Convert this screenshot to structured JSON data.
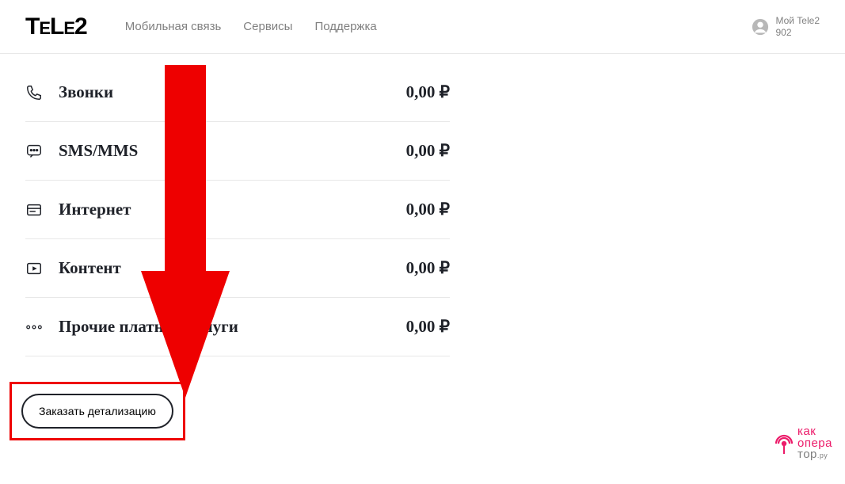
{
  "header": {
    "logo": "TELE2",
    "nav": {
      "mobile": "Мобильная связь",
      "services": "Сервисы",
      "support": "Поддержка"
    },
    "account": {
      "title": "Мой Tele2",
      "number": "902"
    }
  },
  "rows": [
    {
      "icon": "phone-icon",
      "label": "Звонки",
      "amount": "0,00 ₽"
    },
    {
      "icon": "sms-icon",
      "label": "SMS/MMS",
      "amount": "0,00 ₽"
    },
    {
      "icon": "internet-icon",
      "label": "Интернет",
      "amount": "0,00 ₽"
    },
    {
      "icon": "content-icon",
      "label": "Контент",
      "amount": "0,00 ₽"
    },
    {
      "icon": "other-icon",
      "label": "Прочие платные услуги",
      "amount": "0,00 ₽"
    }
  ],
  "button": {
    "order_detail": "Заказать детализацию"
  },
  "watermark": {
    "line1": "как",
    "line2": "опера",
    "line3": "тор",
    "suffix": ".ру"
  },
  "annotation": {
    "highlight_color": "#ee0000"
  }
}
